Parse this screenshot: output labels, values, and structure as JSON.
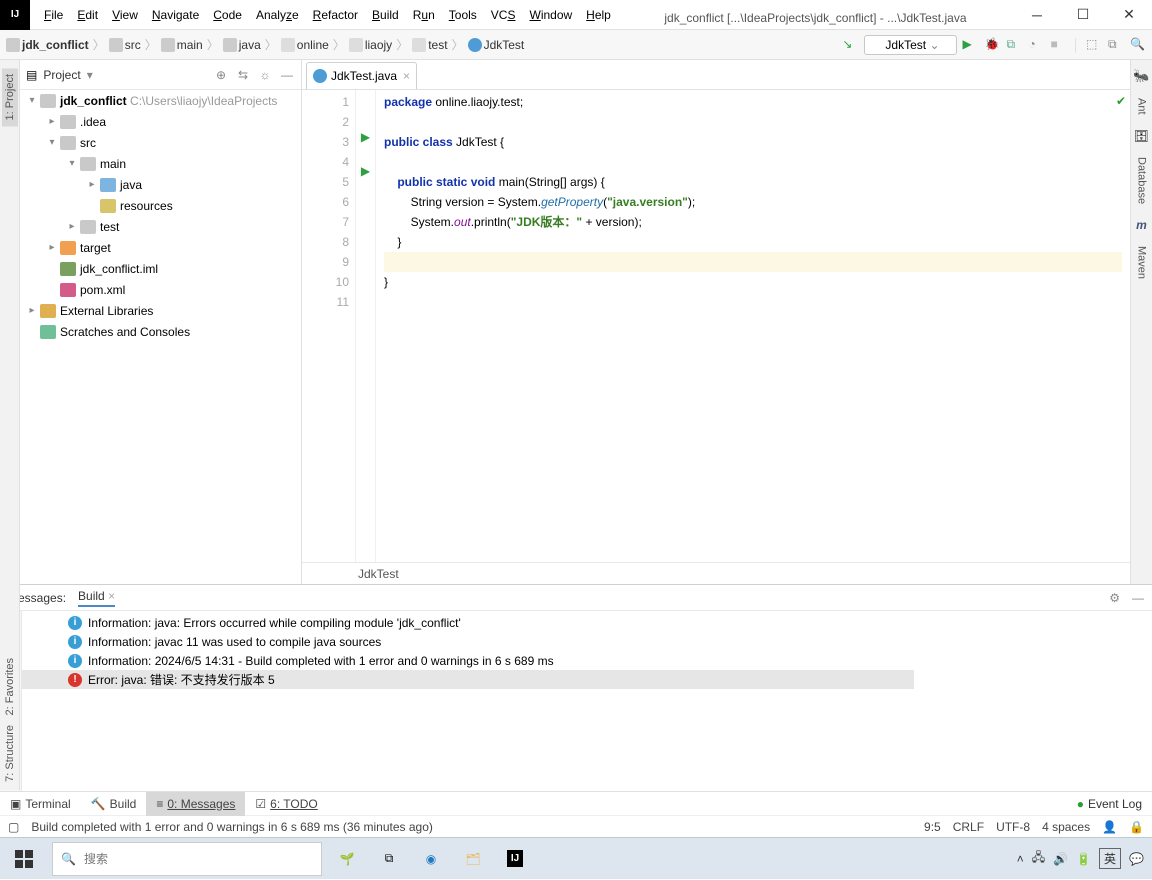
{
  "title": "jdk_conflict [...\\IdeaProjects\\jdk_conflict] - ...\\JdkTest.java",
  "menus": [
    "File",
    "Edit",
    "View",
    "Navigate",
    "Code",
    "Analyze",
    "Refactor",
    "Build",
    "Run",
    "Tools",
    "VCS",
    "Window",
    "Help"
  ],
  "breadcrumb": [
    "jdk_conflict",
    "src",
    "main",
    "java",
    "online",
    "liaojy",
    "test",
    "JdkTest"
  ],
  "run_config": "JdkTest",
  "project_label": "Project",
  "tree": {
    "root": "jdk_conflict",
    "root_path": "C:\\Users\\liaojy\\IdeaProjects",
    "idea": ".idea",
    "src": "src",
    "main": "main",
    "java": "java",
    "resources": "resources",
    "test": "test",
    "target": "target",
    "iml": "jdk_conflict.iml",
    "pom": "pom.xml",
    "ext": "External Libraries",
    "scr": "Scratches and Consoles"
  },
  "editor_tab": "JdkTest.java",
  "editor_crumb": "JdkTest",
  "code_lines": [
    "1",
    "2",
    "3",
    "4",
    "5",
    "6",
    "7",
    "8",
    "9",
    "10",
    "11"
  ],
  "code": {
    "l1a": "package",
    "l1b": " online.liaojy.test;",
    "l3a": "public class",
    "l3b": " JdkTest {",
    "l5a": "public static void",
    "l5b": " main(String[] args) {",
    "l6a": "        String version = System.",
    "l6m": "getProperty",
    "l6b": "(",
    "l6s": "\"java.version\"",
    "l6c": ");",
    "l7a": "        System.",
    "l7f": "out",
    "l7b": ".println(",
    "l7s": "\"JDK版本：\"",
    "l7c": " + version);",
    "l8": "    }",
    "l10": "}"
  },
  "messages_header": {
    "label": "Messages:",
    "tab": "Build"
  },
  "messages": [
    "Information: java: Errors occurred while compiling module 'jdk_conflict'",
    "Information: javac 11 was used to compile java sources",
    "Information: 2024/6/5 14:31 - Build completed with 1 error and 0 warnings in 6 s 689 ms",
    "Error: java: 错误: 不支持发行版本 5"
  ],
  "bottom": {
    "terminal": "Terminal",
    "build": "Build",
    "messages": "0: Messages",
    "todo": "6: TODO",
    "eventlog": "Event Log"
  },
  "status": {
    "text": "Build completed with 1 error and 0 warnings in 6 s 689 ms (36 minutes ago)",
    "pos": "9:5",
    "crlf": "CRLF",
    "enc": "UTF-8",
    "indent": "4 spaces"
  },
  "right_tabs": [
    "Ant",
    "Database",
    "Maven"
  ],
  "left_tabs": [
    "1: Project"
  ],
  "left_lower": [
    "2: Favorites",
    "7: Structure"
  ],
  "taskbar": {
    "search": "搜索",
    "ime": "英",
    "time": "",
    "tray_icons": [
      "up",
      "net",
      "vol",
      "bat"
    ]
  }
}
